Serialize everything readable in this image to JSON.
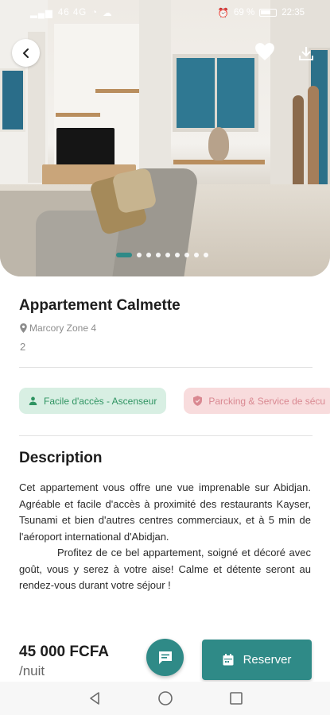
{
  "status_bar": {
    "signal_text": "46 4G",
    "battery": "69 %",
    "time": "22:35"
  },
  "gallery": {
    "image_count": 9,
    "active_index": 0
  },
  "listing": {
    "title": "Appartement Calmette",
    "location": "Marcory Zone 4",
    "rooms": "2"
  },
  "amenities": [
    {
      "label": "Facile d'accès - Ascenseur",
      "icon": "person-icon",
      "color": "#2f9462"
    },
    {
      "label": "Parcking & Service de sécu",
      "icon": "shield-icon",
      "color": "#d98891"
    }
  ],
  "description": {
    "heading": "Description",
    "paragraph1": "Cet appartement vous offre une vue imprenable sur Abidjan. Agréable et facile d'accès à proximité des restaurants Kayser, Tsunami et bien d'autres centres commerciaux, et à 5 min de l'aéroport international d'Abidjan.",
    "paragraph2": "Profitez de ce bel appartement, soigné et décoré avec goût, vous y serez à votre aise! Calme et détente seront au rendez-vous durant votre séjour !"
  },
  "pricing": {
    "price": "45 000 FCFA",
    "unit": "/nuit"
  },
  "actions": {
    "reserve_label": "Reserver"
  },
  "colors": {
    "accent": "#2f8a87",
    "chip_green_bg": "#d8efe3",
    "chip_red_bg": "#f8dcdd"
  }
}
